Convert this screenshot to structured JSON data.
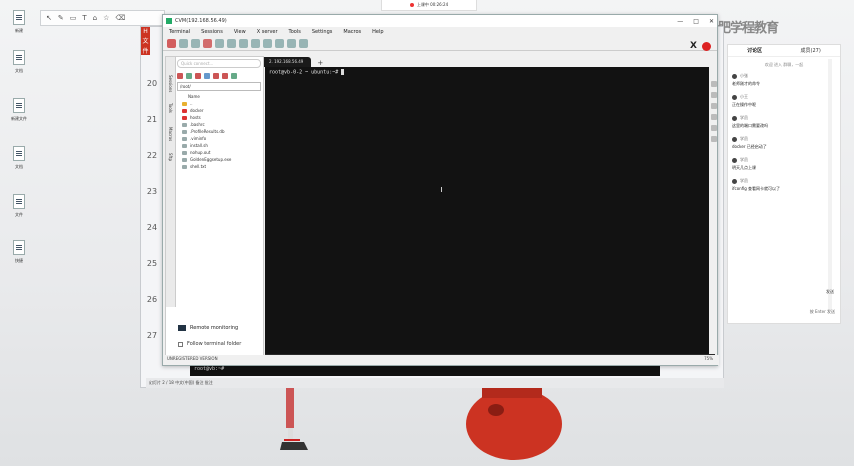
{
  "desktop": {
    "icons": [
      {
        "label": "新建"
      },
      {
        "label": "文档"
      },
      {
        "label": "新建文件"
      },
      {
        "label": "文档"
      },
      {
        "label": "文件"
      },
      {
        "label": "快捷"
      }
    ]
  },
  "topbar": {
    "text": "上课中 00:26:24"
  },
  "watermark": {
    "text": "合肥学程教育"
  },
  "ppt": {
    "badge": "H 文件",
    "row_numbers": [
      "20",
      "21",
      "22",
      "23",
      "24",
      "25",
      "26",
      "27"
    ],
    "cmd_line": "root@vb:~#",
    "status": "幻灯片 2 / 18   中文(中国)   备注   批注"
  },
  "moba": {
    "title": "CVM(192.168.56.49)",
    "window_controls": [
      "—",
      "□",
      "✕"
    ],
    "menu": [
      "Terminal",
      "Sessions",
      "View",
      "X server",
      "Tools",
      "Settings",
      "Macros",
      "Help"
    ],
    "tab_label": "2. 192.168.56.49",
    "tab_add": "+",
    "sidebar": {
      "search_placeholder": "Quick connect...",
      "path": "/root/",
      "vertical_tabs": [
        "Sessions",
        "Tools",
        "Macros",
        "Sftp"
      ],
      "files": [
        {
          "name": "..",
          "type": "up"
        },
        {
          "name": "docker",
          "type": "folder-red"
        },
        {
          "name": "hosts",
          "type": "folder-red"
        },
        {
          "name": ".bashrc",
          "type": "file"
        },
        {
          "name": ".ProfileResults.db",
          "type": "file"
        },
        {
          "name": ".viminfo",
          "type": "file"
        },
        {
          "name": "install.sh",
          "type": "file"
        },
        {
          "name": "nohup.out",
          "type": "file"
        },
        {
          "name": "GoldenEggsetup.exe",
          "type": "file"
        },
        {
          "name": "shell.txt",
          "type": "file"
        }
      ],
      "name_col": "Name",
      "remote_monitoring": "Remote monitoring",
      "follow_terminal": "Follow terminal folder"
    },
    "terminal": {
      "prompt": "root@vb-0-2 ~ ubuntu:~#"
    },
    "status": [
      "root@ubuntu",
      "0%",
      "3.07 GB / 7.79 GB",
      "0.10 Mb/s",
      "0.10 Mb/s",
      "90 days",
      "root",
      "root: 4%",
      "/: 22%",
      "/boot: 0%",
      "/sys/fs/cgroup"
    ],
    "footer_left": "UNREGISTERED VERSION",
    "footer_right": "75%"
  },
  "chat": {
    "tabs": [
      "讨论区",
      "成员(27)"
    ],
    "system": "欢迎 进入 群聊，一起",
    "messages": [
      {
        "user": "小张",
        "text": "老师刚才的命令"
      },
      {
        "user": "小王",
        "text": "正在操作中呢"
      },
      {
        "user": "学员",
        "text": "这里的端口需要改吗"
      },
      {
        "user": "学员",
        "text": "docker 已经启动了"
      },
      {
        "user": "学员",
        "text": "明天几点上课"
      },
      {
        "user": "学员",
        "text": "ifconfig 查看网卡就可以了"
      }
    ],
    "send": "发送",
    "input_hint": "按 Enter 发送"
  },
  "annot_tools": [
    "↖",
    "✎",
    "▭",
    "T",
    "⌂",
    "☆",
    "⌫"
  ],
  "colors": {
    "accent_red": "#cc3322",
    "terminal_bg": "#121212"
  }
}
